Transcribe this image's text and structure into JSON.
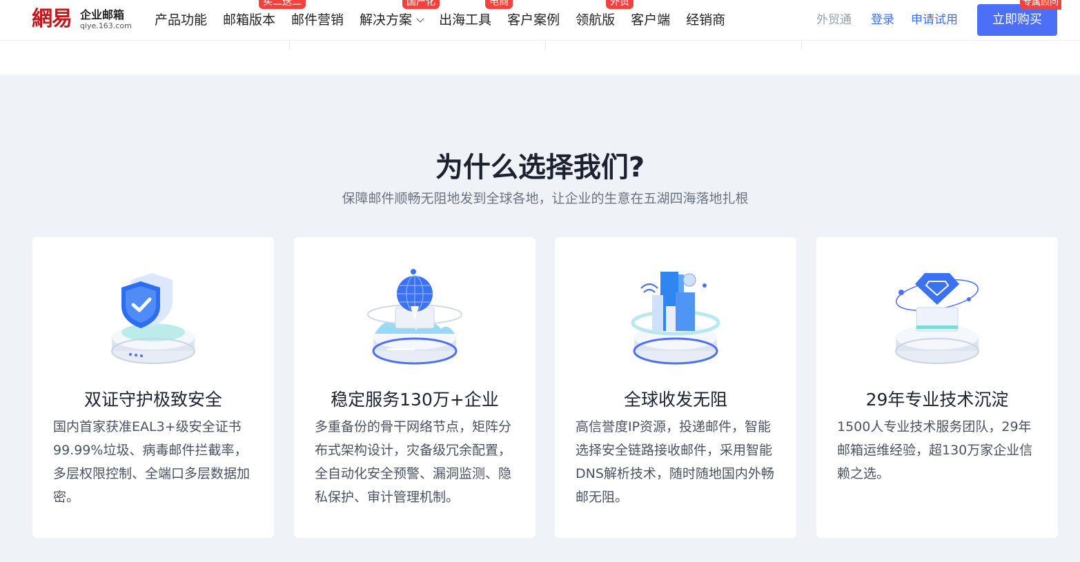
{
  "header": {
    "logo_mark": "網易",
    "logo_line1": "企业邮箱",
    "logo_line2": "qiye.163.com",
    "nav": [
      {
        "label": "产品功能",
        "badge": ""
      },
      {
        "label": "邮箱版本",
        "badge": "买二送二"
      },
      {
        "label": "邮件营销",
        "badge": ""
      },
      {
        "label": "解决方案",
        "badge": "国产化"
      },
      {
        "label": "出海工具",
        "badge": "电商"
      },
      {
        "label": "客户案例",
        "badge": ""
      },
      {
        "label": "领航版",
        "badge": "外贸"
      },
      {
        "label": "客户端",
        "badge": ""
      },
      {
        "label": "经销商",
        "badge": ""
      }
    ],
    "waimao": "外贸通",
    "login": "登录",
    "trial": "申请试用",
    "buy": "立即购买",
    "buy_badge": "专属顾问"
  },
  "section": {
    "title": "为什么选择我们?",
    "subtitle": "保障邮件顺畅无阻地发到全球各地，让企业的生意在五湖四海落地扎根"
  },
  "cards": [
    {
      "icon": "shield-icon",
      "title": "双证守护极致安全",
      "desc": "国内首家获准EAL3+级安全证书99.99%垃圾、病毒邮件拦截率，多层权限控制、全端口多层数据加密。"
    },
    {
      "icon": "globe-server-icon",
      "title": "稳定服务130万+企业",
      "desc": "多重备份的骨干网络节点，矩阵分布式架构设计，灾备级冗余配置，全自动化安全预警、漏洞监测、隐私保护、审计管理机制。"
    },
    {
      "icon": "building-signal-icon",
      "title": "全球收发无阻",
      "desc": "高信誉度IP资源，投递邮件，智能选择安全链路接收邮件，采用智能DNS解析技术，随时随地国内外畅邮无阻。"
    },
    {
      "icon": "diamond-server-icon",
      "title": "29年专业技术沉淀",
      "desc": "1500人专业技术服务团队，29年邮箱运维经验，超130万家企业信赖之选。"
    }
  ],
  "colors": {
    "accent": "#4b6ff7",
    "badge": "#f0433f",
    "brand_red": "#c4161c",
    "bg": "#eff3f8"
  }
}
